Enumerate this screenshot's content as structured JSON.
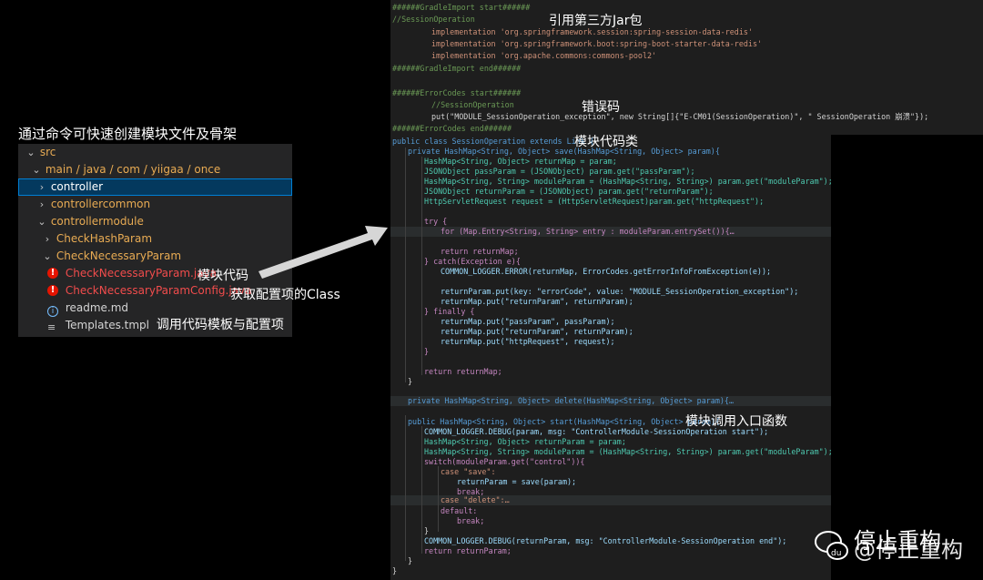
{
  "caption": "通过命令可快速创建模块文件及骨架",
  "explorer": {
    "rows": [
      {
        "label": "src"
      },
      {
        "label": "main / java / com / yiigaa / once"
      },
      {
        "label": "controller"
      },
      {
        "label": "controllercommon"
      },
      {
        "label": "controllermodule"
      },
      {
        "label": "CheckHashParam"
      },
      {
        "label": "CheckNecessaryParam"
      },
      {
        "label": "CheckNecessaryParam.java",
        "annotation": "模块代码"
      },
      {
        "label": "CheckNecessaryParamConfig.java",
        "annotation": "获取配置项的Class"
      },
      {
        "label": "readme.md"
      },
      {
        "label": "Templates.tmpl",
        "annotation": "调用代码模板与配置项"
      }
    ]
  },
  "annotations": {
    "jar": "引用第三方Jar包",
    "errcode": "错误码",
    "module_class": "模块代码类",
    "entry": "模块调用入口函数"
  },
  "code": {
    "l01": "######GradleImport start######",
    "l02": "//SessionOperation",
    "l03": "implementation 'org.springframework.session:spring-session-data-redis'",
    "l04": "implementation 'org.springframework.boot:spring-boot-starter-data-redis'",
    "l05": "implementation 'org.apache.commons:commons-pool2'",
    "l06": "######GradleImport end######",
    "l07": "######ErrorCodes start######",
    "l08": "//SessionOperation",
    "l09": "put(\"MODULE_SessionOperation_exception\", new String[]{\"E-CM01(SessionOperation)\", \" SessionOperation 崩溃\"});",
    "l10": "######ErrorCodes end######",
    "l11": "public class SessionOperation extends Link {",
    "l12": "private HashMap<String, Object> save(HashMap<String, Object> param){",
    "l13": "HashMap<String, Object> returnMap = param;",
    "l14": "JSONObject passParam = (JSONObject) param.get(\"passParam\");",
    "l15": "HashMap<String, String> moduleParam = (HashMap<String, String>) param.get(\"moduleParam\");",
    "l16": "JSONObject returnParam = (JSONObject) param.get(\"returnParam\");",
    "l17": "HttpServletRequest request = (HttpServletRequest)param.get(\"httpRequest\");",
    "l18": "try {",
    "l19": "for (Map.Entry<String, String> entry : moduleParam.entrySet()){…",
    "l20": "return returnMap;",
    "l21": "} catch(Exception e){",
    "l22": "COMMON_LOGGER.ERROR(returnMap, ErrorCodes.getErrorInfoFromException(e));",
    "l23": "returnParam.put(key: \"errorCode\", value: \"MODULE_SessionOperation_exception\");",
    "l24": "returnMap.put(\"returnParam\", returnParam);",
    "l25": "} finally {",
    "l26": "returnMap.put(\"passParam\", passParam);",
    "l27": "returnMap.put(\"returnParam\", returnParam);",
    "l28": "returnMap.put(\"httpRequest\", request);",
    "l29": "}",
    "l30": "return returnMap;",
    "l31": "}",
    "l32": "private HashMap<String, Object> delete(HashMap<String, Object> param){…",
    "l33": "public HashMap<String, Object> start(HashMap<String, Object> param){",
    "l34": "COMMON_LOGGER.DEBUG(param, msg: \"ControllerModule-SessionOperation start\");",
    "l35": "HashMap<String, Object> returnParam = param;",
    "l36": "HashMap<String, String> moduleParam = (HashMap<String, String>) param.get(\"moduleParam\");",
    "l37": "switch(moduleParam.get(\"control\")){",
    "l38": "case \"save\":",
    "l39": "returnParam = save(param);",
    "l40": "break;",
    "l41": "case \"delete\":…",
    "l42": "default:",
    "l43": "break;",
    "l44": "}",
    "l45": "COMMON_LOGGER.DEBUG(returnParam, msg: \"ControllerModule-SessionOperation end\");",
    "l46": "return returnParam;",
    "l47": "}",
    "l48": "}"
  },
  "watermark": {
    "icon": "wechat-icon",
    "text_back": "停止重构",
    "text_front": "@停止重构"
  },
  "colors": {
    "editor_bg": "#1e1e1e",
    "explorer_bg": "#252526",
    "selection": "#04395e",
    "keyword": "#569cd6",
    "type": "#4ec9b0",
    "string": "#ce9178",
    "comment": "#6a9955"
  }
}
